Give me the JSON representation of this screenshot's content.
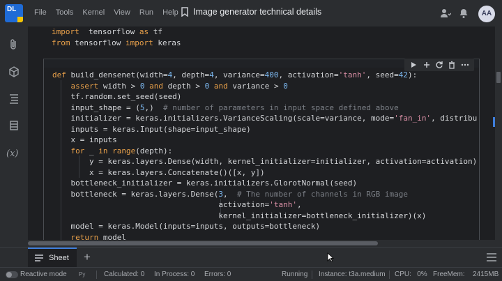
{
  "app": {
    "logo_text": "DL",
    "title": "Image generator technical details"
  },
  "menu": [
    "File",
    "Tools",
    "Kernel",
    "View",
    "Run",
    "Help"
  ],
  "user": {
    "initials": "AA"
  },
  "cell1_lines": [
    [
      [
        "kw",
        "import"
      ],
      [
        "",
        "  tensorflow "
      ],
      [
        "kw",
        "as"
      ],
      [
        "",
        " tf"
      ]
    ],
    [
      [
        "kw",
        "from"
      ],
      [
        "",
        " tensorflow "
      ],
      [
        "kw",
        "import"
      ],
      [
        "",
        " keras"
      ]
    ]
  ],
  "cell2_lines": [
    [
      [
        "kw",
        "def"
      ],
      [
        "",
        " build_densenet(width="
      ],
      [
        "num",
        "4"
      ],
      [
        "",
        ", depth="
      ],
      [
        "num",
        "4"
      ],
      [
        "",
        ", variance="
      ],
      [
        "num",
        "400"
      ],
      [
        "",
        ", activation="
      ],
      [
        "str",
        "'tanh'"
      ],
      [
        "",
        ", seed="
      ],
      [
        "num",
        "42"
      ],
      [
        "",
        "):"
      ]
    ],
    [
      [
        "",
        "    "
      ],
      [
        "kw",
        "assert"
      ],
      [
        "",
        " width > "
      ],
      [
        "num",
        "0"
      ],
      [
        "",
        " "
      ],
      [
        "kw",
        "and"
      ],
      [
        "",
        " depth > "
      ],
      [
        "num",
        "0"
      ],
      [
        "",
        " "
      ],
      [
        "kw",
        "and"
      ],
      [
        "",
        " variance > "
      ],
      [
        "num",
        "0"
      ]
    ],
    [
      [
        "",
        "    tf.random.set_seed(seed)"
      ]
    ],
    [
      [
        "",
        "    input_shape = ("
      ],
      [
        "num",
        "5"
      ],
      [
        "",
        ",)  "
      ],
      [
        "cmt",
        "# number of parameters in input space defined above"
      ]
    ],
    [
      [
        "",
        "    initializer = keras.initializers.VarianceScaling(scale=variance, mode="
      ],
      [
        "str",
        "'fan_in'"
      ],
      [
        "",
        ", distribu"
      ]
    ],
    [
      [
        "",
        "    inputs = keras.Input(shape=input_shape)"
      ]
    ],
    [
      [
        "",
        "    x = inputs"
      ]
    ],
    [
      [
        "",
        "    "
      ],
      [
        "kw",
        "for"
      ],
      [
        "",
        " _ "
      ],
      [
        "kw",
        "in"
      ],
      [
        "",
        " "
      ],
      [
        "kw",
        "range"
      ],
      [
        "",
        "(depth):"
      ]
    ],
    [
      [
        "",
        "        y = keras.layers.Dense(width, kernel_initializer=initializer, activation=activation)"
      ]
    ],
    [
      [
        "",
        "        x = keras.layers.Concatenate()([x, y])"
      ]
    ],
    [
      [
        "",
        "    bottleneck_initializer = keras.initializers.GlorotNormal(seed)"
      ]
    ],
    [
      [
        "",
        "    bottleneck = keras.layers.Dense("
      ],
      [
        "num",
        "3"
      ],
      [
        "",
        ",  "
      ],
      [
        "cmt",
        "# The number of channels in RGB image"
      ]
    ],
    [
      [
        "",
        "                                    activation="
      ],
      [
        "str",
        "'tanh'"
      ],
      [
        "",
        ","
      ]
    ],
    [
      [
        "",
        "                                    kernel_initializer=bottleneck_initializer)(x)"
      ]
    ],
    [
      [
        "",
        "    model = keras.Model(inputs=inputs, outputs=bottleneck)"
      ]
    ],
    [
      [
        "",
        "    "
      ],
      [
        "kw",
        "return"
      ],
      [
        "",
        " model"
      ]
    ]
  ],
  "tabs": {
    "sheet_label": "Sheet",
    "add_label": "+"
  },
  "status": {
    "reactive": "Reactive mode",
    "kernel_badge": "Py",
    "calculated": "Calculated: 0",
    "in_process": "In Process: 0",
    "errors": "Errors: 0",
    "state": "Running",
    "instance": "Instance: t3a.medium",
    "cpu": "CPU:   0%",
    "freemem": "FreeMem:",
    "freemem_value": "2415MB"
  },
  "colors": {
    "keyword": "#e8a04a",
    "string": "#d98fa5",
    "number": "#7cb8f0",
    "comment": "#7b7f86",
    "accent": "#3f7edb"
  }
}
